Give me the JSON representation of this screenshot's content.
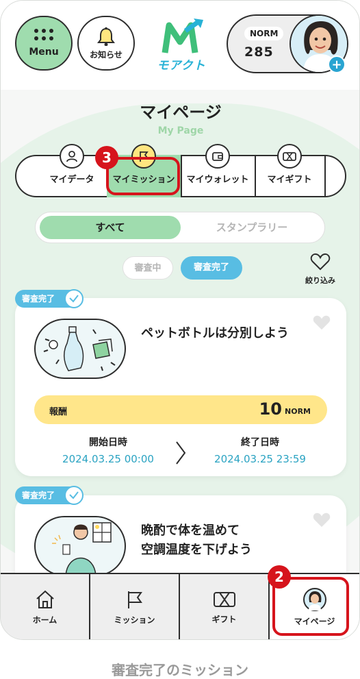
{
  "header": {
    "menu_label": "Menu",
    "notice_label": "お知らせ",
    "logo_text": "モアクト",
    "rank_badge": "NORM",
    "points": "285",
    "add_label": "+"
  },
  "page": {
    "title": "マイページ",
    "subtitle": "My Page"
  },
  "tabs": [
    {
      "label": "マイデータ",
      "icon": "user-icon"
    },
    {
      "label": "マイミッション",
      "icon": "flag-icon"
    },
    {
      "label": "マイウォレット",
      "icon": "wallet-icon"
    },
    {
      "label": "マイギフト",
      "icon": "gift-icon"
    }
  ],
  "active_tab": 1,
  "segment": {
    "all_label": "すべて",
    "stamp_label": "スタンプラリー"
  },
  "chips": {
    "reviewing": "審査中",
    "approved": "審査完了"
  },
  "filter_label": "絞り込み",
  "annotations": {
    "step_tab": "3",
    "step_nav": "2",
    "caption": "審査完了のミッション"
  },
  "missions": [
    {
      "status": "審査完了",
      "title": "ペットボトルは分別しよう",
      "reward_label": "報酬",
      "reward_value": "10",
      "reward_unit": "NORM",
      "start_head": "開始日時",
      "start_value": "2024.03.25 00:00",
      "end_head": "終了日時",
      "end_value": "2024.03.25 23:59"
    },
    {
      "status": "審査完了",
      "title_line1": "晩酌で体を温めて",
      "title_line2": "空調温度を下げよう"
    }
  ],
  "bottom_nav": [
    {
      "label": "ホーム",
      "icon": "home-icon"
    },
    {
      "label": "ミッション",
      "icon": "flag-icon"
    },
    {
      "label": "ギフト",
      "icon": "gift-icon"
    },
    {
      "label": "マイページ",
      "icon": "avatar-icon"
    }
  ],
  "colors": {
    "accent_green": "#9fdcae",
    "accent_blue": "#58bde3",
    "reward_yellow": "#ffe68a",
    "annotation_red": "#d6141c"
  }
}
